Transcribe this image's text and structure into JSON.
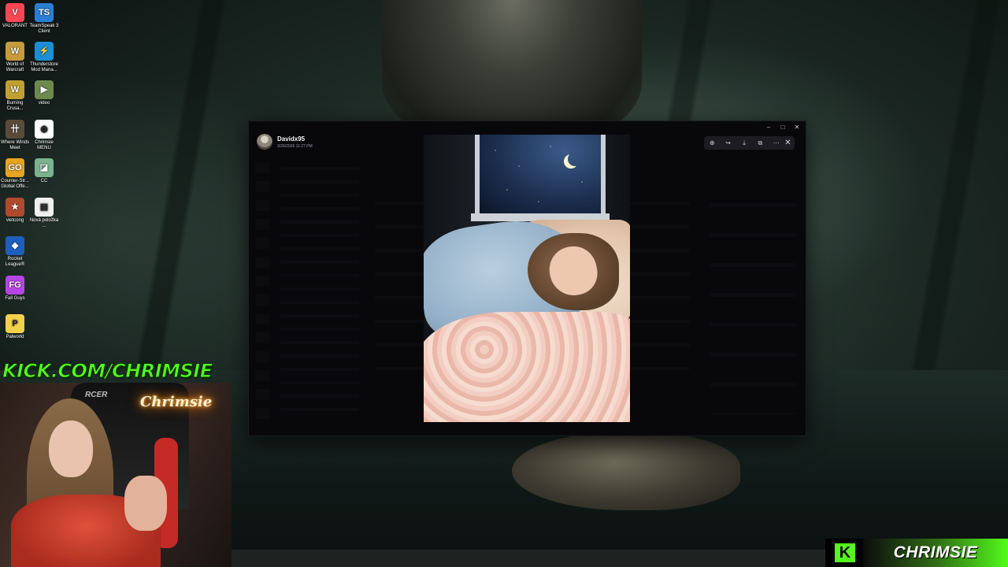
{
  "desktop": {
    "icons": [
      {
        "label": "VALORANT",
        "glyph": "V",
        "color": "#ff4655"
      },
      {
        "label": "TeamSpeak 3 Client",
        "glyph": "TS",
        "color": "#2a7fd4"
      },
      {
        "label": "World of Warcraft",
        "glyph": "W",
        "color": "#c69b3a"
      },
      {
        "label": "Thunderstore Mod Mana...",
        "glyph": "⚡",
        "color": "#1b8fd4"
      },
      {
        "label": "Burning Crusa...",
        "glyph": "W",
        "color": "#c0a030"
      },
      {
        "label": "video",
        "glyph": "▶",
        "color": "#6c8a4e"
      },
      {
        "label": "Where Winds Meet",
        "glyph": "卄",
        "color": "#5a4a3a"
      },
      {
        "label": "Chrimsie MENU",
        "glyph": "◉",
        "color": "#ffffff"
      },
      {
        "label": "Counter-Str... Global Offe...",
        "glyph": "GO",
        "color": "#e7a321"
      },
      {
        "label": "CC",
        "glyph": "◪",
        "color": "#7bb28f"
      },
      {
        "label": "vietcong",
        "glyph": "★",
        "color": "#b04a2e"
      },
      {
        "label": "Nová položka ...",
        "glyph": "▤",
        "color": "#f0f0f0"
      },
      {
        "label": "Rocket League®",
        "glyph": "◆",
        "color": "#1d5fbf"
      },
      {
        "label": "Fall Guys",
        "glyph": "FG",
        "color": "#b644e6"
      },
      {
        "label": "Palworld",
        "glyph": "P",
        "color": "#f1d24a"
      }
    ]
  },
  "overlay": {
    "kick_url": "KICK.COM/CHRIMSIE",
    "neon_sign": "Chrimsie",
    "chair_brand": "RCER",
    "badge_letter": "K",
    "badge_name": "CHRIMSIE",
    "kick_color": "#53fc18"
  },
  "discord": {
    "viewer": {
      "username": "Davidx95",
      "timestamp": "3/26/2026 11:27 PM",
      "tools": [
        {
          "name": "zoom-icon",
          "glyph": "⊕"
        },
        {
          "name": "forward-icon",
          "glyph": "↪"
        },
        {
          "name": "download-icon",
          "glyph": "⤓"
        },
        {
          "name": "open-in-browser-icon",
          "glyph": "⧉"
        },
        {
          "name": "more-icon",
          "glyph": "⋯"
        }
      ],
      "close_glyph": "✕"
    },
    "window_controls": [
      "–",
      "□",
      "✕"
    ]
  }
}
